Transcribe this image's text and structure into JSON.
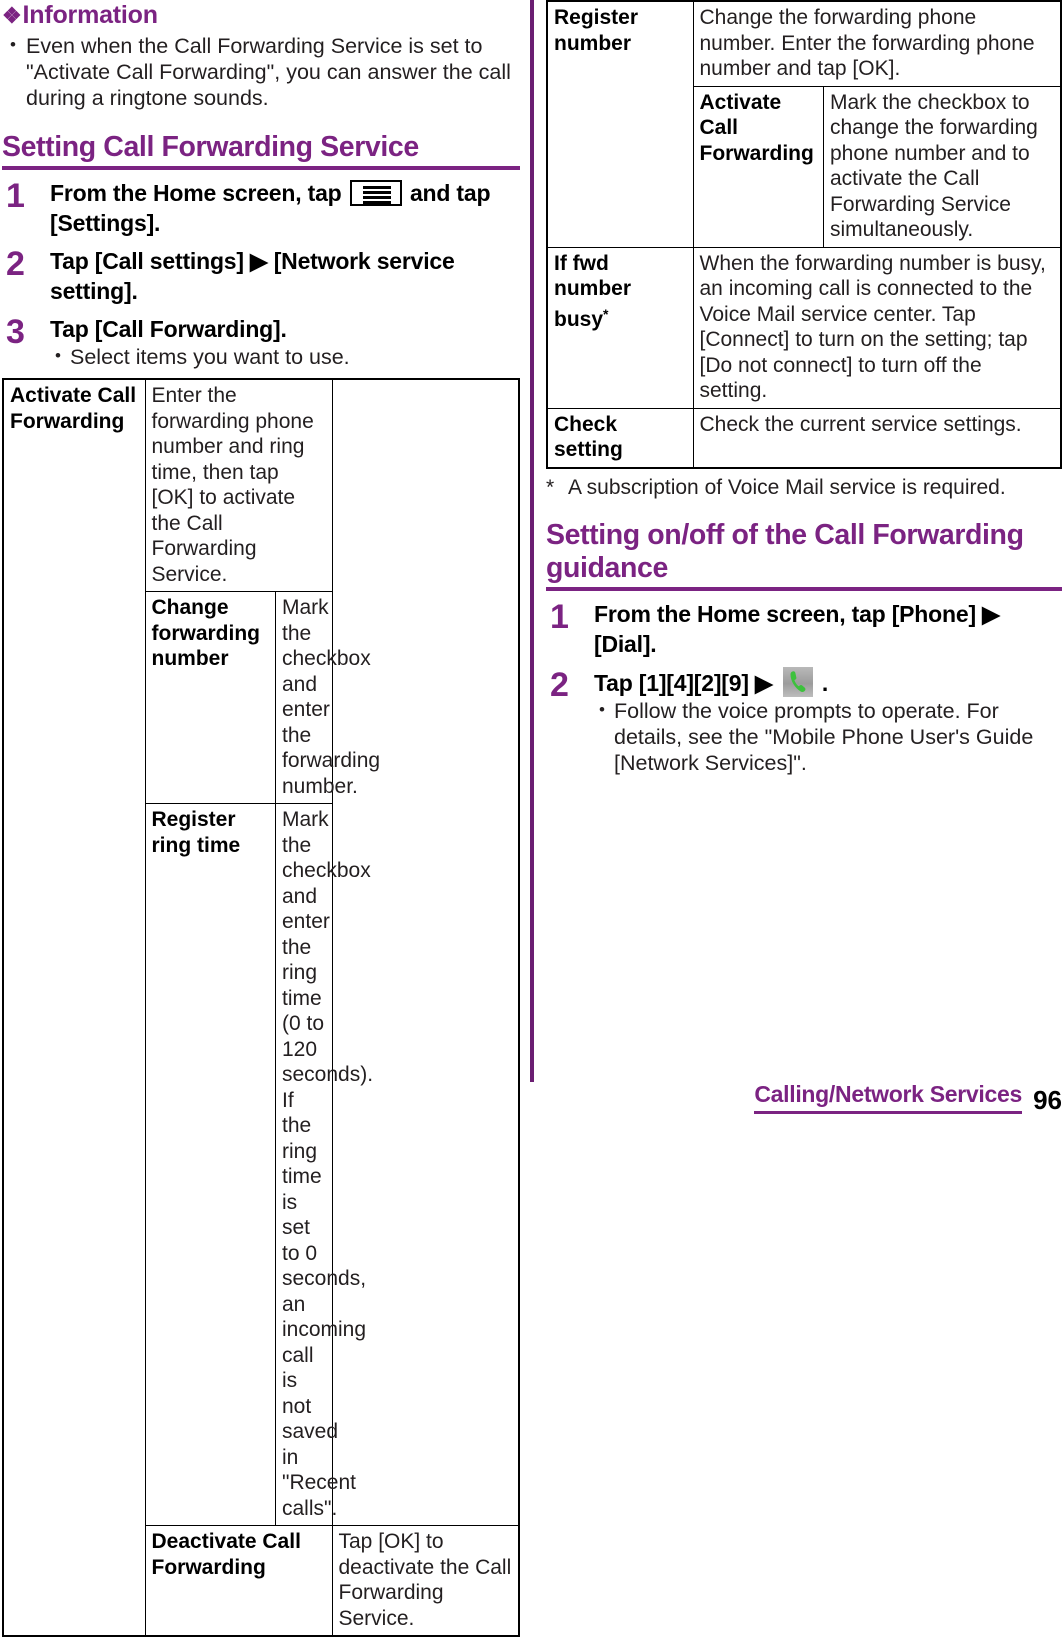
{
  "left_column": {
    "information": {
      "icon": "diamond-cluster-icon",
      "heading": "Information",
      "bullets": [
        "Even when the Call Forwarding Service is set to \"Activate Call Forwarding\", you can answer the call during a ringtone sounds."
      ]
    },
    "section": {
      "heading": "Setting Call Forwarding Service"
    },
    "steps": [
      {
        "number": "1",
        "title_before_icon": "From the Home screen, tap",
        "icon": "menu-key-icon",
        "title_after_icon": "and tap [Settings].",
        "sub": []
      },
      {
        "number": "2",
        "title": "Tap [Call settings] ▶ [Network service setting].",
        "sub": []
      },
      {
        "number": "3",
        "title": "Tap [Call Forwarding].",
        "sub": [
          "Select items you want to use."
        ]
      }
    ],
    "table": {
      "rows": [
        {
          "key": "Activate Call Forwarding",
          "desc": "Enter the forwarding phone number and ring time, then tap [OK] to activate the Call Forwarding Service.",
          "sub_rows": [
            {
              "key": "Change forwarding number",
              "desc": "Mark the checkbox and enter the forwarding number."
            },
            {
              "key": "Register ring time",
              "desc": "Mark the checkbox and enter the ring time (0 to 120 seconds).\nIf the ring time is set to 0 seconds, an incoming call is not saved in \"Recent calls\"."
            }
          ]
        },
        {
          "key": "Deactivate Call Forwarding",
          "desc": "Tap [OK] to deactivate the Call Forwarding Service.",
          "sub_rows": []
        }
      ]
    }
  },
  "right_column": {
    "table": {
      "rows": [
        {
          "key": "Register number",
          "desc": "Change the forwarding phone number. Enter the forwarding phone number and tap [OK].",
          "sub_rows": [
            {
              "key": "Activate Call Forwarding",
              "desc": "Mark the checkbox to change the forwarding phone number and to activate the Call Forwarding Service simultaneously."
            }
          ]
        },
        {
          "key": "If fwd number busy",
          "key_sup": "*",
          "desc": "When the forwarding number is busy, an incoming call is connected to the Voice Mail service center. Tap [Connect] to turn on the setting; tap [Do not connect] to turn off the setting.",
          "sub_rows": []
        },
        {
          "key": "Check setting",
          "desc": "Check the current service settings.",
          "sub_rows": []
        }
      ]
    },
    "footnote": {
      "mark": "*",
      "text": "A subscription of Voice Mail service is required."
    },
    "section": {
      "heading": "Setting on/off of the Call Forwarding guidance"
    },
    "steps": [
      {
        "number": "1",
        "title": "From the Home screen, tap [Phone] ▶ [Dial].",
        "sub": []
      },
      {
        "number": "2",
        "title_before_icon": "Tap [1][4][2][9] ▶",
        "icon": "green-phone-handset-icon",
        "title_after_icon": ".",
        "sub": [
          "Follow the voice prompts to operate. For details, see the \"Mobile Phone User's Guide [Network Services]\"."
        ]
      }
    ]
  },
  "footer": {
    "title": "Calling/Network Services",
    "page_number": "96"
  },
  "colors": {
    "accent_purple": "#7B2382",
    "divider_purple": "#6B1E72",
    "body_text": "#231f20",
    "phone_icon_green": "#3DC13D"
  }
}
